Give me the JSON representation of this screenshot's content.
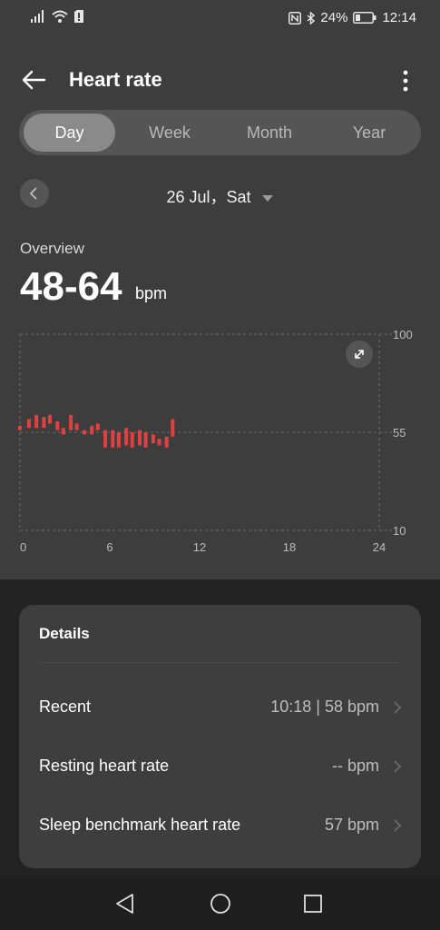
{
  "status_bar": {
    "battery_percent": "24%",
    "time": "12:14",
    "icons": [
      "signal-icon",
      "wifi-icon",
      "sim-alert-icon",
      "nfc-icon",
      "bluetooth-icon",
      "battery-icon"
    ]
  },
  "app_bar": {
    "title": "Heart rate",
    "icons": [
      "back-arrow-icon",
      "more-vert-icon"
    ]
  },
  "tabs": [
    {
      "label": "Day",
      "active": true
    },
    {
      "label": "Week",
      "active": false
    },
    {
      "label": "Month",
      "active": false
    },
    {
      "label": "Year",
      "active": false
    }
  ],
  "date": {
    "label": "26 Jul，Sat",
    "icons": [
      "chevron-left-icon",
      "dropdown-triangle-icon"
    ]
  },
  "overview": {
    "label": "Overview",
    "value": "48-64",
    "unit": "bpm"
  },
  "chart_data": {
    "type": "bar",
    "subtype": "range",
    "y_ticks": [
      "100",
      "55",
      "10"
    ],
    "x_ticks": [
      "0",
      "6",
      "12",
      "18",
      "24"
    ],
    "ylim": [
      10,
      100
    ],
    "xlim": [
      0,
      24
    ],
    "grid": true,
    "bar_color": "#e04040",
    "ranges": [
      {
        "x": 0.0,
        "low": 56,
        "high": 58
      },
      {
        "x": 0.6,
        "low": 57,
        "high": 61
      },
      {
        "x": 1.1,
        "low": 57,
        "high": 63
      },
      {
        "x": 1.6,
        "low": 57,
        "high": 62
      },
      {
        "x": 2.0,
        "low": 59,
        "high": 63
      },
      {
        "x": 2.5,
        "low": 56,
        "high": 60
      },
      {
        "x": 2.9,
        "low": 54,
        "high": 57
      },
      {
        "x": 3.4,
        "low": 56,
        "high": 63
      },
      {
        "x": 3.8,
        "low": 56,
        "high": 59
      },
      {
        "x": 4.3,
        "low": 54,
        "high": 56
      },
      {
        "x": 4.8,
        "low": 54,
        "high": 58
      },
      {
        "x": 5.2,
        "low": 56,
        "high": 59
      },
      {
        "x": 5.7,
        "low": 48,
        "high": 56
      },
      {
        "x": 6.2,
        "low": 48,
        "high": 56
      },
      {
        "x": 6.6,
        "low": 48,
        "high": 55
      },
      {
        "x": 7.1,
        "low": 49,
        "high": 57
      },
      {
        "x": 7.5,
        "low": 48,
        "high": 55
      },
      {
        "x": 8.0,
        "low": 49,
        "high": 56
      },
      {
        "x": 8.4,
        "low": 48,
        "high": 55
      },
      {
        "x": 8.9,
        "low": 50,
        "high": 54
      },
      {
        "x": 9.3,
        "low": 49,
        "high": 52
      },
      {
        "x": 9.8,
        "low": 48,
        "high": 53
      },
      {
        "x": 10.2,
        "low": 53,
        "high": 61
      }
    ],
    "icons": [
      "expand-icon"
    ]
  },
  "details": {
    "title": "Details",
    "rows": [
      {
        "label": "Recent",
        "value": "10:18 | 58 bpm"
      },
      {
        "label": "Resting heart rate",
        "value": "-- bpm"
      },
      {
        "label": "Sleep benchmark heart rate",
        "value": "57 bpm"
      }
    ]
  },
  "nav_bar": {
    "icons": [
      "nav-back-icon",
      "nav-home-icon",
      "nav-recents-icon"
    ]
  }
}
